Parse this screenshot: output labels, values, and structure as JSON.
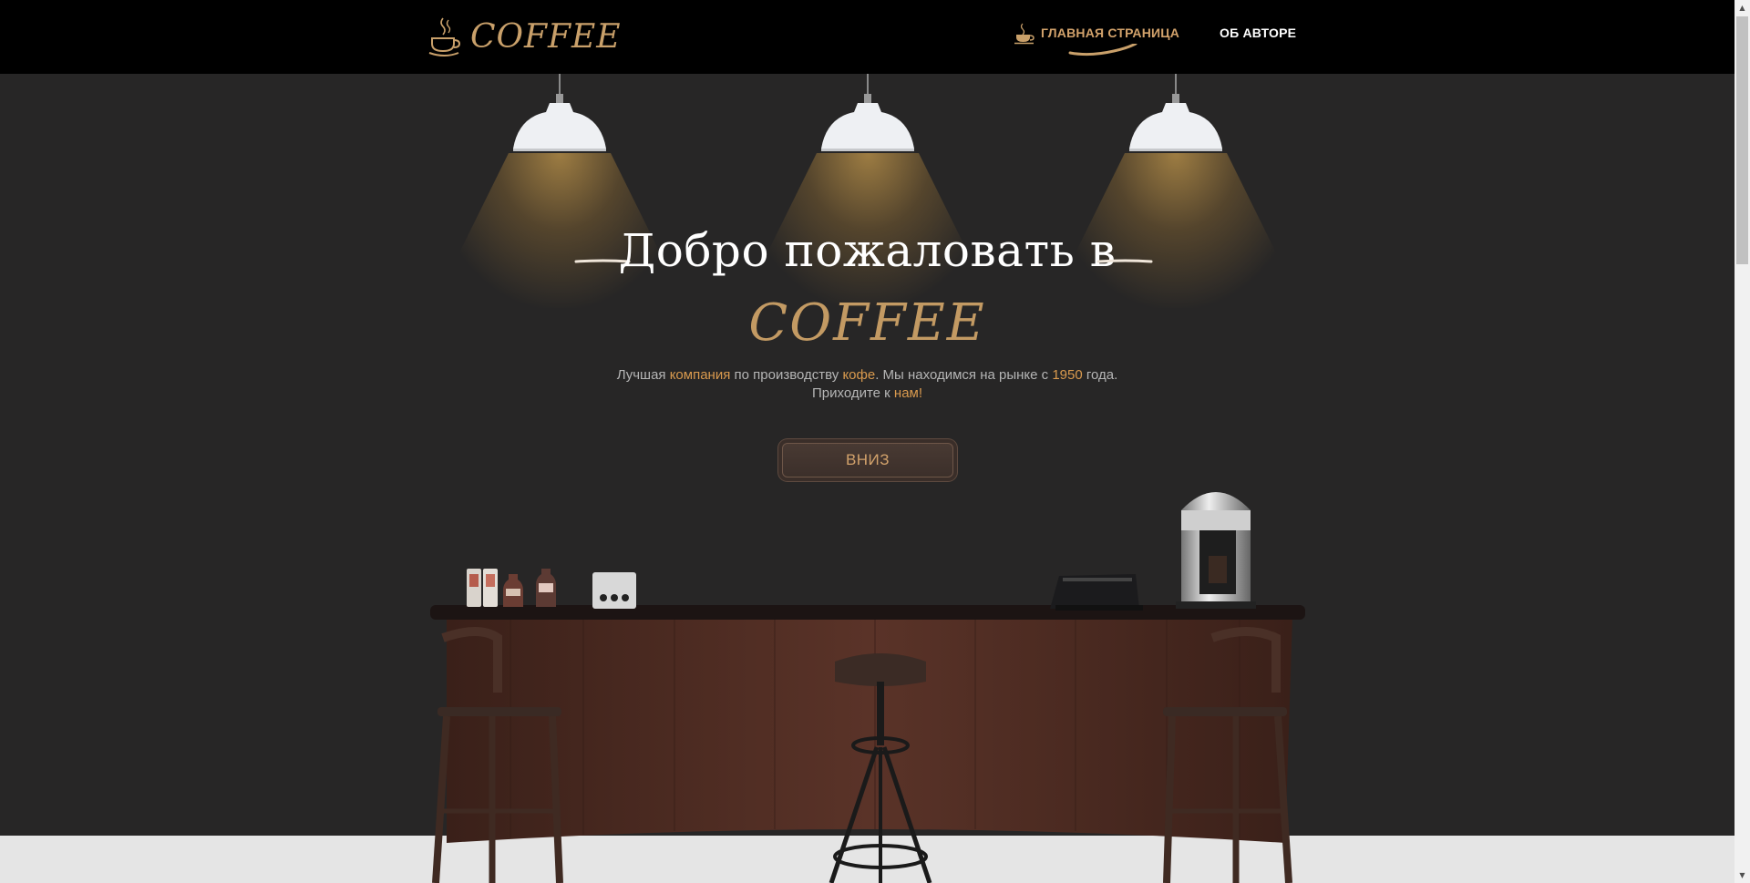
{
  "header": {
    "logo_text": "COFFEE",
    "nav": [
      {
        "label": "ГЛАВНАЯ СТРАНИЦА",
        "active": true
      },
      {
        "label": "ОБ АВТОРЕ",
        "active": false
      }
    ]
  },
  "hero": {
    "title": "Добро пожаловать в",
    "brand": "COFFEE",
    "desc_line1": {
      "p1": "Лучшая ",
      "h1": "компания",
      "p2": " по производству ",
      "h2": "кофе",
      "p3": ". Мы находимся на рынке с ",
      "h3": "1950",
      "p4": " года."
    },
    "desc_line2": {
      "p1": "Приходите к ",
      "h1": "нам!"
    },
    "button_label": "ВНИЗ"
  },
  "colors": {
    "accent": "#d2a26b",
    "brand": "#c39a63",
    "header_bg": "#000000",
    "page_bg": "#272626",
    "counter_wood": "#4a2a22",
    "floor": "#e5e5e5"
  },
  "icons": [
    "coffee-cup-icon",
    "nav-coffee-cup-icon",
    "pendant-lamp",
    "coffee-machine",
    "cash-register",
    "bar-stool"
  ]
}
